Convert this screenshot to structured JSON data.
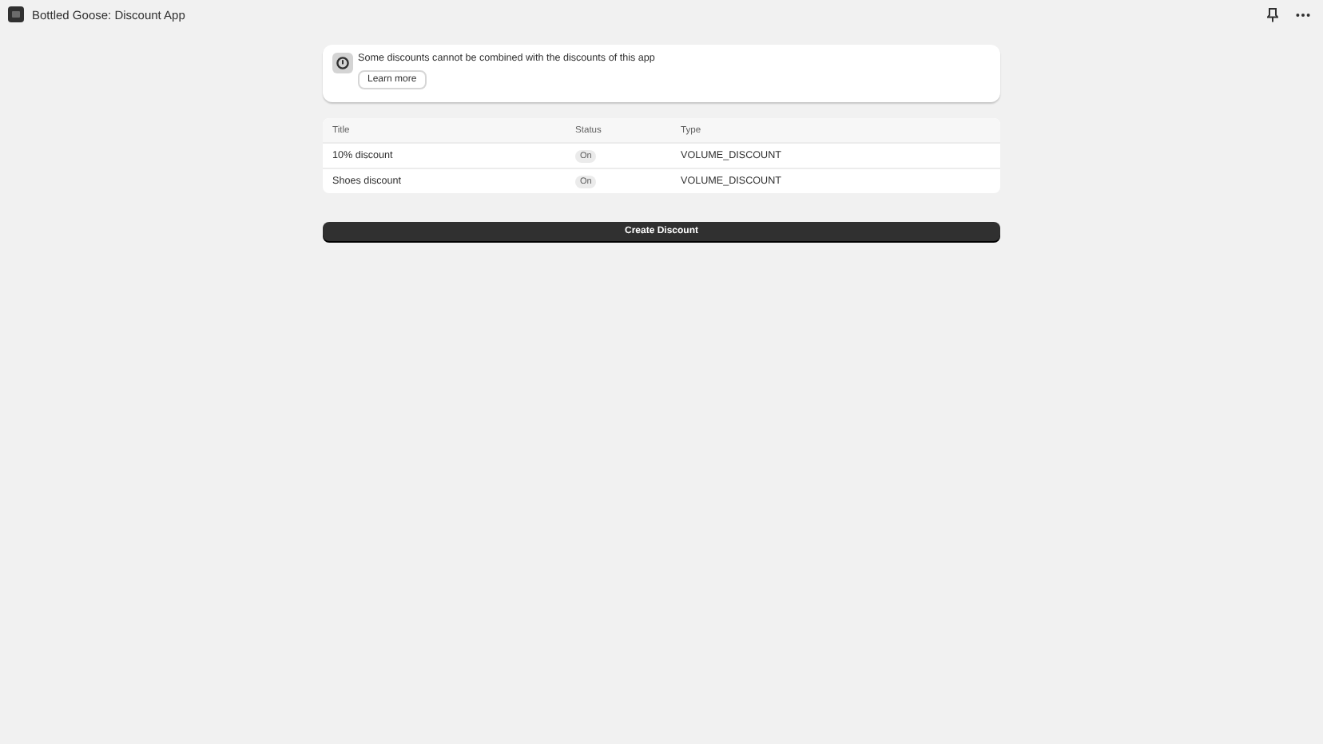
{
  "window": {
    "title": "Bottled Goose: Discount App"
  },
  "banner": {
    "message": "Some discounts cannot be combined with the discounts of this app",
    "action": "Learn more"
  },
  "table": {
    "columns": [
      "Title",
      "Status",
      "Type"
    ],
    "rows": [
      {
        "title": "10% discount",
        "status": "On",
        "type": "VOLUME_DISCOUNT"
      },
      {
        "title": "Shoes discount",
        "status": "On",
        "type": "VOLUME_DISCOUNT"
      }
    ]
  },
  "primary_button": "Create Discount"
}
